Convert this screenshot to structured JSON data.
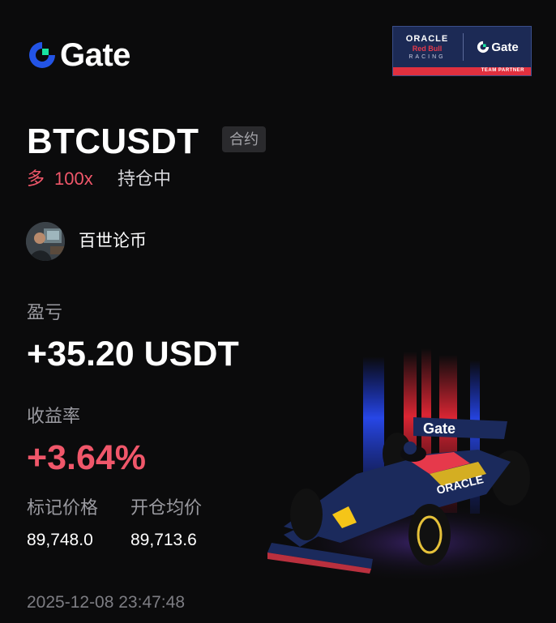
{
  "brand": {
    "logo_text": "Gate"
  },
  "partner_badge": {
    "sponsor": "ORACLE",
    "team": "Red Bull",
    "racing": "RACING",
    "brand": "Gate",
    "caption": "TEAM PARTNER"
  },
  "position": {
    "symbol": "BTCUSDT",
    "type_tag": "合约",
    "side": "多",
    "leverage": "100x",
    "status": "持仓中"
  },
  "user": {
    "name": "百世论币"
  },
  "pnl": {
    "label": "盈亏",
    "value": "+35.20 USDT"
  },
  "roi": {
    "label": "收益率",
    "value": "+3.64%"
  },
  "mark_price": {
    "label": "标记价格",
    "value": "89,748.0"
  },
  "entry_price": {
    "label": "开仓均价",
    "value": "89,713.6"
  },
  "timestamp": "2025-12-08 23:47:48",
  "colors": {
    "profit": "#f0576a",
    "brand_blue": "#2354e6",
    "brand_green": "#17e5a1",
    "background": "#0b0b0c"
  },
  "icons": {
    "logo": "gate-logo-icon",
    "car": "f1-car-illustration"
  }
}
